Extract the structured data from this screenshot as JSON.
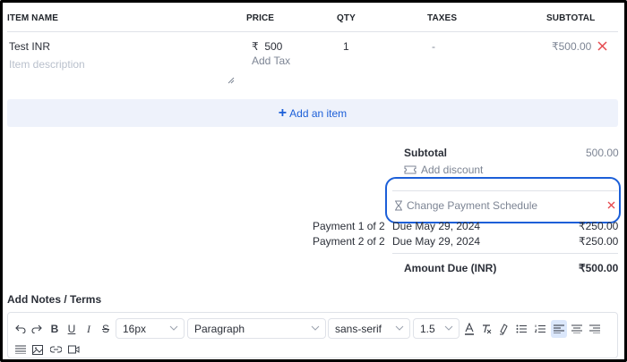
{
  "table": {
    "headers": {
      "item_name": "ITEM NAME",
      "price": "PRICE",
      "qty": "QTY",
      "taxes": "TAXES",
      "subtotal": "SUBTOTAL"
    },
    "row": {
      "name": "Test INR",
      "description_placeholder": "Item description",
      "currency_symbol": "₹",
      "price": "500",
      "add_tax": "Add Tax",
      "qty": "1",
      "taxes": "-",
      "subtotal": "₹500.00"
    }
  },
  "add_item_label": "Add an item",
  "summary": {
    "subtotal_label": "Subtotal",
    "subtotal_value": "500.00",
    "add_discount": "Add discount",
    "change_schedule": "Change Payment Schedule",
    "payments": [
      {
        "label": "Payment 1 of 2",
        "date": "Due May 29, 2024",
        "amount": "₹250.00"
      },
      {
        "label": "Payment 2 of 2",
        "date": "Due May 29, 2024",
        "amount": "₹250.00"
      }
    ],
    "amount_due_label": "Amount Due (INR)",
    "amount_due_value": "₹500.00"
  },
  "notes": {
    "title": "Add Notes / Terms",
    "font_size": "16px",
    "block_type": "Paragraph",
    "font_family": "sans-serif",
    "line_height": "1.5"
  },
  "colors": {
    "accent": "#1c5fd8",
    "danger": "#e5484d",
    "row_bg": "#eef2fb"
  }
}
